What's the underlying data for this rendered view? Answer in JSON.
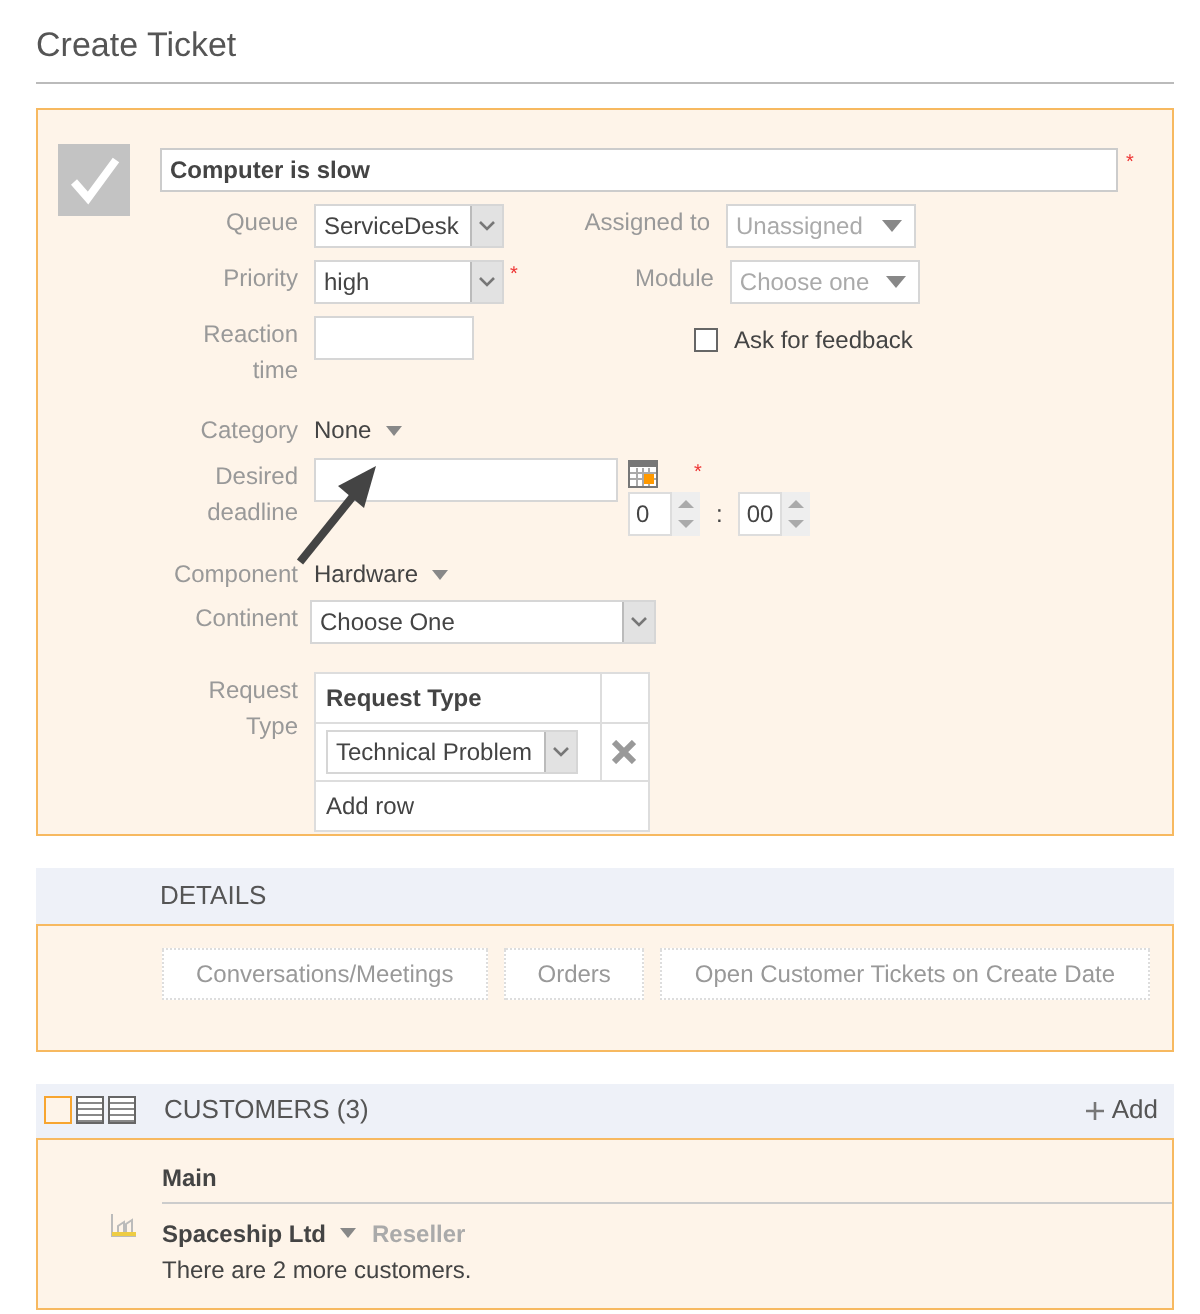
{
  "page_title": "Create Ticket",
  "ticket": {
    "title_value": "Computer is slow",
    "title_required": "*",
    "queue": {
      "label": "Queue",
      "value": "ServiceDesk"
    },
    "assigned_to": {
      "label": "Assigned to",
      "placeholder": "Unassigned"
    },
    "priority": {
      "label": "Priority",
      "value": "high",
      "required": "*"
    },
    "module": {
      "label": "Module",
      "placeholder": "Choose one"
    },
    "reaction_time": {
      "label": "Reaction time"
    },
    "feedback": {
      "label": "Ask for feedback",
      "checked": false
    },
    "category": {
      "label": "Category",
      "value": "None"
    },
    "deadline": {
      "label": "Desired deadline",
      "required": "*",
      "hour": "0",
      "minute": "00",
      "separator": ":"
    },
    "component": {
      "label": "Component",
      "value": "Hardware"
    },
    "continent": {
      "label": "Continent",
      "value": "Choose One"
    },
    "request_type": {
      "label": "Request Type",
      "column": "Request Type",
      "rows": [
        {
          "value": "Technical Problem"
        }
      ],
      "add_row": "Add row"
    }
  },
  "details": {
    "heading": "DETAILS",
    "buttons": [
      "Conversations/Meetings",
      "Orders",
      "Open Customer Tickets on Create Date"
    ]
  },
  "customers": {
    "heading": "CUSTOMERS (3)",
    "add": "Add",
    "views": [
      {
        "selected": true
      },
      {
        "selected": false
      },
      {
        "selected": false
      }
    ],
    "group": "Main",
    "name": "Spaceship Ltd",
    "role": "Reseller",
    "more": "There are 2 more customers."
  }
}
